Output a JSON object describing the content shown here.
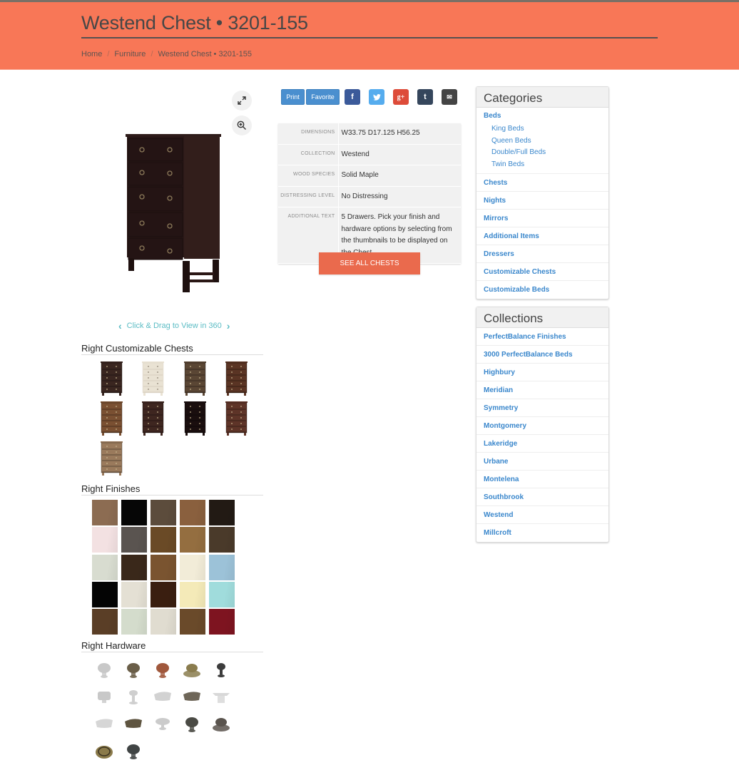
{
  "header": {
    "title": "Westend Chest • 3201-155",
    "breadcrumb": [
      "Home",
      "Furniture",
      "Westend Chest • 3201-155"
    ],
    "breadcrumb_sep": "/",
    "bg_color": "#f87757"
  },
  "viewer": {
    "fullscreen_icon": "expand-icon",
    "zoom_icon": "zoom-in-icon",
    "view360_label": "Click & Drag to View in 360",
    "prev_icon": "chevron-left-icon",
    "next_icon": "chevron-right-icon"
  },
  "sections": {
    "chests_title": "Right Customizable Chests",
    "finishes_title": "Right Finishes",
    "hardware_title": "Right Hardware"
  },
  "chests": [
    {
      "tone": "#3a2620"
    },
    {
      "tone": "#e9e2d3"
    },
    {
      "tone": "#5a4634"
    },
    {
      "tone": "#5a3424"
    },
    {
      "tone": "#7a5032"
    },
    {
      "tone": "#3e2620"
    },
    {
      "tone": "#1a0e0e"
    },
    {
      "tone": "#5e3428"
    },
    {
      "tone": "#9a7a5c"
    }
  ],
  "finishes": [
    "#8c6c52",
    "#060606",
    "#5c4c3c",
    "#8a603e",
    "#221a14",
    "#f3e1e2",
    "#5a5450",
    "#6a4a26",
    "#946e40",
    "#4a3a2a",
    "#d8dcd0",
    "#3a281a",
    "#7a5430",
    "#f2ecd8",
    "#9cc2d8",
    "#040404",
    "#e4e0d4",
    "#3a1e10",
    "#f4eab8",
    "#a0dcdc",
    "#5a3e26",
    "#d4dccc",
    "#e0dcd0",
    "#6a4a2a",
    "#7e1420"
  ],
  "hardware": [
    {
      "color": "#c8c8c8",
      "shape": "round"
    },
    {
      "color": "#6a5e48",
      "shape": "round"
    },
    {
      "color": "#a0583c",
      "shape": "round"
    },
    {
      "color": "#8a7c4e",
      "shape": "backplate"
    },
    {
      "color": "#3c3c3c",
      "shape": "small-round"
    },
    {
      "color": "#c8c8c8",
      "shape": "square"
    },
    {
      "color": "#cfcfcf",
      "shape": "mushroom"
    },
    {
      "color": "#d2d2d2",
      "shape": "oblong"
    },
    {
      "color": "#6e6658",
      "shape": "oblong"
    },
    {
      "color": "#d8d8d8",
      "shape": "square-top"
    },
    {
      "color": "#d6d6d6",
      "shape": "oblong"
    },
    {
      "color": "#5e5440",
      "shape": "oblong"
    },
    {
      "color": "#cbcbcb",
      "shape": "oval"
    },
    {
      "color": "#4a4a44",
      "shape": "round"
    },
    {
      "color": "#5a544e",
      "shape": "backplate"
    },
    {
      "color": "#8a7a4a",
      "shape": "ring"
    },
    {
      "color": "#404444",
      "shape": "round"
    }
  ],
  "actions": {
    "print_label": "Print",
    "favorite_label": "Favorite",
    "social": [
      {
        "name": "facebook",
        "glyph": "f",
        "color": "#3b5a9a"
      },
      {
        "name": "twitter",
        "glyph": "t",
        "color": "#55acee"
      },
      {
        "name": "google-plus",
        "glyph": "g+",
        "color": "#dd4b39"
      },
      {
        "name": "tumblr",
        "glyph": "t",
        "color": "#35465c"
      },
      {
        "name": "email",
        "glyph": "✉",
        "color": "#444444"
      }
    ]
  },
  "specs": [
    {
      "label": "Dimensions",
      "value": "W33.75 D17.125 H56.25"
    },
    {
      "label": "Collection",
      "value": "Westend"
    },
    {
      "label": "Wood Species",
      "value": "Solid Maple"
    },
    {
      "label": "Distressing Level",
      "value": "No Distressing"
    },
    {
      "label": "Additional Text",
      "value": "5 Drawers. Pick your finish and hardware options by selecting from the thumbnails to be displayed on the Chest."
    }
  ],
  "see_all_label": "SEE ALL CHESTS",
  "categories": {
    "title": "Categories",
    "beds": {
      "label": "Beds",
      "children": [
        "King Beds",
        "Queen Beds",
        "Double/Full Beds",
        "Twin Beds"
      ]
    },
    "items": [
      "Chests",
      "Nights",
      "Mirrors",
      "Additional Items",
      "Dressers",
      "Customizable Chests",
      "Customizable Beds"
    ]
  },
  "collections": {
    "title": "Collections",
    "items": [
      "PerfectBalance Finishes",
      "3000 PerfectBalance Beds",
      "Highbury",
      "Meridian",
      "Symmetry",
      "Montgomery",
      "Lakeridge",
      "Urbane",
      "Montelena",
      "Southbrook",
      "Westend",
      "Millcroft"
    ]
  },
  "colors": {
    "link": "#3a87cc",
    "accent_button": "#ea6a4d",
    "view360": "#5bbcc4"
  }
}
